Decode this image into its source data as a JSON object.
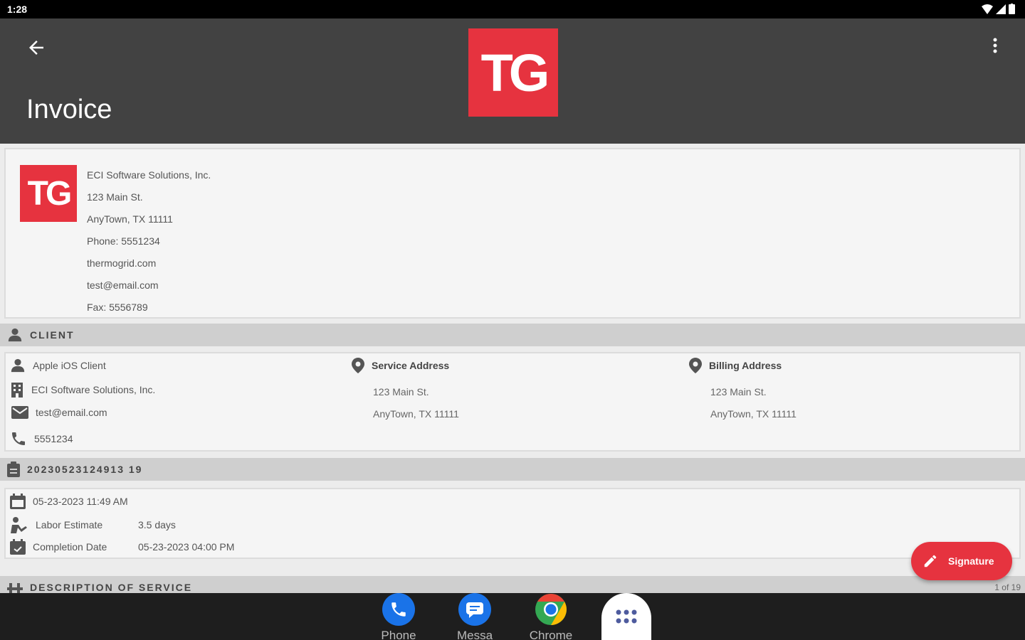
{
  "status_bar": {
    "time": "1:28"
  },
  "app_bar": {
    "title": "Invoice",
    "logo_text": "TG"
  },
  "company": {
    "logo_text": "TG",
    "lines": [
      "ECI Software Solutions, Inc.",
      "123 Main St.",
      "AnyTown, TX 11111",
      "Phone: 5551234",
      "thermogrid.com",
      "test@email.com",
      "Fax: 5556789"
    ]
  },
  "client_section": {
    "header": "CLIENT",
    "name": "Apple iOS Client",
    "company": "ECI Software Solutions, Inc.",
    "email": "test@email.com",
    "phone": "5551234",
    "service_address": {
      "title": "Service Address",
      "line1": "123 Main St.",
      "line2": "AnyTown, TX 11111"
    },
    "billing_address": {
      "title": "Billing Address",
      "line1": "123 Main St.",
      "line2": "AnyTown, TX 11111"
    }
  },
  "invoice_section": {
    "number": "20230523124913 19",
    "date": "05-23-2023 11:49 AM",
    "labor_label": "Labor Estimate",
    "labor_value": "3.5 days",
    "completion_label": "Completion Date",
    "completion_value": "05-23-2023 04:00 PM"
  },
  "description_section": {
    "header": "DESCRIPTION OF SERVICE",
    "page_count": "1 of 19"
  },
  "fab": {
    "label": "Signature"
  },
  "dock": {
    "apps": [
      {
        "label": "Phone",
        "icon": "phone-icon"
      },
      {
        "label": "Messa",
        "icon": "message-icon"
      },
      {
        "label": "Chrome",
        "icon": "chrome-icon"
      }
    ],
    "drawer_icon": "app-drawer-icon"
  },
  "colors": {
    "brand_red": "#e6333f",
    "app_bar": "#424242",
    "section_bar": "#cfcfcf"
  }
}
